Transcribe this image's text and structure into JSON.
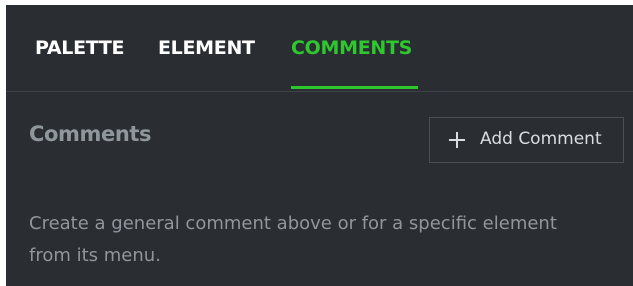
{
  "tabs": {
    "palette": "PALETTE",
    "element": "ELEMENT",
    "comments": "COMMENTS",
    "active": "comments"
  },
  "comments": {
    "title": "Comments",
    "add_button_label": "Add Comment",
    "hint_text": "Create a general comment above or for a specific element from its menu."
  },
  "colors": {
    "background": "#2a2e33",
    "accent": "#2ec72e",
    "tab_text": "#ffffff",
    "muted_text": "#8f969c"
  },
  "icons": {
    "add": "plus-icon"
  }
}
